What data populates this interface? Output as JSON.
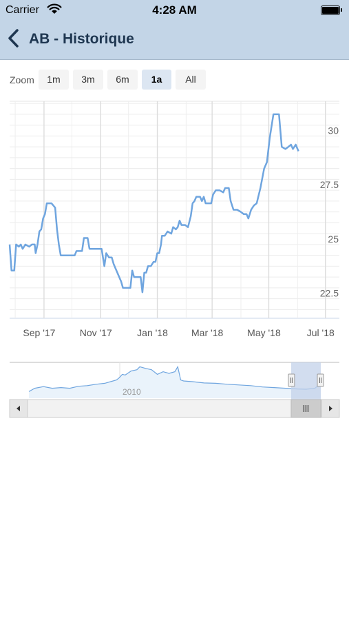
{
  "status": {
    "carrier": "Carrier",
    "time": "4:28 AM"
  },
  "nav": {
    "title": "AB - Historique"
  },
  "zoom": {
    "label": "Zoom",
    "buttons": [
      "1m",
      "3m",
      "6m",
      "1a",
      "All"
    ],
    "selected": "1a"
  },
  "colors": {
    "header": "#c3d5e7",
    "line": "#6fa5df",
    "navigator_mask": "#c3d1ea"
  },
  "chart_data": {
    "type": "line",
    "x_tick_labels": [
      "Sep '17",
      "Nov '17",
      "Jan '18",
      "Mar '18",
      "May '18",
      "Jul '18"
    ],
    "y_tick_labels": [
      "22.5",
      "25",
      "27.5",
      "30"
    ],
    "y_ticks": [
      22.5,
      25,
      27.5,
      30
    ],
    "ylim": [
      21.6,
      31.6
    ],
    "xlim": [
      "2017-07-26",
      "2018-07-16"
    ],
    "grid": true,
    "series": [
      {
        "points": [
          [
            "2017-07-26",
            25.0
          ],
          [
            "2017-07-28",
            23.8
          ],
          [
            "2017-07-31",
            23.8
          ],
          [
            "2017-08-02",
            25.0
          ],
          [
            "2017-08-05",
            24.9
          ],
          [
            "2017-08-07",
            25.0
          ],
          [
            "2017-08-09",
            24.8
          ],
          [
            "2017-08-12",
            25.0
          ],
          [
            "2017-08-16",
            24.9
          ],
          [
            "2017-08-19",
            25.0
          ],
          [
            "2017-08-22",
            25.0
          ],
          [
            "2017-08-23",
            24.6
          ],
          [
            "2017-08-25",
            25.0
          ],
          [
            "2017-08-27",
            25.6
          ],
          [
            "2017-08-29",
            25.7
          ],
          [
            "2017-08-31",
            26.2
          ],
          [
            "2017-09-02",
            26.4
          ],
          [
            "2017-09-04",
            26.9
          ],
          [
            "2017-09-07",
            26.9
          ],
          [
            "2017-09-09",
            26.9
          ],
          [
            "2017-09-11",
            26.8
          ],
          [
            "2017-09-13",
            26.7
          ],
          [
            "2017-09-15",
            25.7
          ],
          [
            "2017-09-17",
            25.0
          ],
          [
            "2017-09-19",
            24.5
          ],
          [
            "2017-09-23",
            24.5
          ],
          [
            "2017-09-28",
            24.5
          ],
          [
            "2017-10-04",
            24.5
          ],
          [
            "2017-10-06",
            24.7
          ],
          [
            "2017-10-10",
            24.7
          ],
          [
            "2017-10-12",
            24.7
          ],
          [
            "2017-10-14",
            25.3
          ],
          [
            "2017-10-16",
            25.3
          ],
          [
            "2017-10-18",
            25.3
          ],
          [
            "2017-10-20",
            24.8
          ],
          [
            "2017-10-24",
            24.8
          ],
          [
            "2017-10-28",
            24.8
          ],
          [
            "2017-10-31",
            24.8
          ],
          [
            "2017-11-02",
            24.8
          ],
          [
            "2017-11-05",
            24.0
          ],
          [
            "2017-11-07",
            24.6
          ],
          [
            "2017-11-10",
            24.4
          ],
          [
            "2017-11-13",
            24.4
          ],
          [
            "2017-11-15",
            24.1
          ],
          [
            "2017-11-17",
            23.9
          ],
          [
            "2017-11-19",
            23.7
          ],
          [
            "2017-11-21",
            23.5
          ],
          [
            "2017-11-23",
            23.3
          ],
          [
            "2017-11-25",
            23.0
          ],
          [
            "2017-11-28",
            23.0
          ],
          [
            "2017-12-01",
            23.0
          ],
          [
            "2017-12-03",
            23.0
          ],
          [
            "2017-12-05",
            23.8
          ],
          [
            "2017-12-07",
            23.5
          ],
          [
            "2017-12-09",
            23.5
          ],
          [
            "2017-12-11",
            23.5
          ],
          [
            "2017-12-14",
            23.5
          ],
          [
            "2017-12-16",
            22.8
          ],
          [
            "2017-12-18",
            23.7
          ],
          [
            "2017-12-20",
            23.7
          ],
          [
            "2017-12-22",
            24.0
          ],
          [
            "2017-12-25",
            24.0
          ],
          [
            "2017-12-28",
            24.2
          ],
          [
            "2017-12-30",
            24.2
          ],
          [
            "2018-01-01",
            24.6
          ],
          [
            "2018-01-03",
            24.6
          ],
          [
            "2018-01-05",
            25.0
          ],
          [
            "2018-01-06",
            25.4
          ],
          [
            "2018-01-09",
            25.4
          ],
          [
            "2018-01-12",
            25.6
          ],
          [
            "2018-01-16",
            25.5
          ],
          [
            "2018-01-18",
            25.8
          ],
          [
            "2018-01-21",
            25.7
          ],
          [
            "2018-01-23",
            25.8
          ],
          [
            "2018-01-25",
            26.1
          ],
          [
            "2018-01-27",
            25.9
          ],
          [
            "2018-01-31",
            25.9
          ],
          [
            "2018-02-03",
            25.8
          ],
          [
            "2018-02-06",
            26.3
          ],
          [
            "2018-02-08",
            26.9
          ],
          [
            "2018-02-10",
            27.0
          ],
          [
            "2018-02-12",
            27.2
          ],
          [
            "2018-02-16",
            27.2
          ],
          [
            "2018-02-18",
            27.0
          ],
          [
            "2018-02-20",
            27.2
          ],
          [
            "2018-02-22",
            26.9
          ],
          [
            "2018-02-24",
            26.9
          ],
          [
            "2018-02-26",
            26.9
          ],
          [
            "2018-02-28",
            26.9
          ],
          [
            "2018-03-02",
            27.3
          ],
          [
            "2018-03-05",
            27.5
          ],
          [
            "2018-03-09",
            27.5
          ],
          [
            "2018-03-13",
            27.4
          ],
          [
            "2018-03-15",
            27.6
          ],
          [
            "2018-03-19",
            27.6
          ],
          [
            "2018-03-21",
            27.0
          ],
          [
            "2018-03-24",
            26.6
          ],
          [
            "2018-03-28",
            26.6
          ],
          [
            "2018-04-01",
            26.5
          ],
          [
            "2018-04-04",
            26.4
          ],
          [
            "2018-04-07",
            26.4
          ],
          [
            "2018-04-09",
            26.2
          ],
          [
            "2018-04-12",
            26.6
          ],
          [
            "2018-04-15",
            26.8
          ],
          [
            "2018-04-18",
            26.9
          ],
          [
            "2018-04-22",
            27.6
          ],
          [
            "2018-04-26",
            28.5
          ],
          [
            "2018-04-29",
            28.8
          ],
          [
            "2018-05-02",
            29.9
          ],
          [
            "2018-05-06",
            31.0
          ],
          [
            "2018-05-12",
            31.0
          ],
          [
            "2018-05-15",
            29.5
          ],
          [
            "2018-05-19",
            29.4
          ],
          [
            "2018-05-22",
            29.5
          ],
          [
            "2018-05-25",
            29.6
          ],
          [
            "2018-05-27",
            29.4
          ],
          [
            "2018-05-30",
            29.6
          ],
          [
            "2018-06-02",
            29.3
          ]
        ]
      }
    ],
    "navigator": {
      "label": "2010",
      "series": [
        [
          0.0,
          0.2
        ],
        [
          0.02,
          0.3
        ],
        [
          0.05,
          0.35
        ],
        [
          0.08,
          0.3
        ],
        [
          0.11,
          0.32
        ],
        [
          0.14,
          0.3
        ],
        [
          0.17,
          0.36
        ],
        [
          0.2,
          0.38
        ],
        [
          0.23,
          0.42
        ],
        [
          0.26,
          0.45
        ],
        [
          0.28,
          0.5
        ],
        [
          0.3,
          0.55
        ],
        [
          0.31,
          0.62
        ],
        [
          0.32,
          0.72
        ],
        [
          0.33,
          0.7
        ],
        [
          0.35,
          0.82
        ],
        [
          0.37,
          0.86
        ],
        [
          0.38,
          0.95
        ],
        [
          0.4,
          0.9
        ],
        [
          0.42,
          0.86
        ],
        [
          0.44,
          0.72
        ],
        [
          0.46,
          0.8
        ],
        [
          0.48,
          0.75
        ],
        [
          0.5,
          0.8
        ],
        [
          0.51,
          0.95
        ],
        [
          0.52,
          0.55
        ],
        [
          0.53,
          0.52
        ],
        [
          0.56,
          0.5
        ],
        [
          0.6,
          0.46
        ],
        [
          0.64,
          0.45
        ],
        [
          0.68,
          0.42
        ],
        [
          0.72,
          0.4
        ],
        [
          0.76,
          0.38
        ],
        [
          0.8,
          0.34
        ],
        [
          0.84,
          0.32
        ],
        [
          0.88,
          0.3
        ],
        [
          0.92,
          0.28
        ],
        [
          0.95,
          0.27
        ],
        [
          0.98,
          0.3
        ],
        [
          1.0,
          0.45
        ]
      ],
      "selection": [
        0.922,
        1.0
      ]
    }
  }
}
